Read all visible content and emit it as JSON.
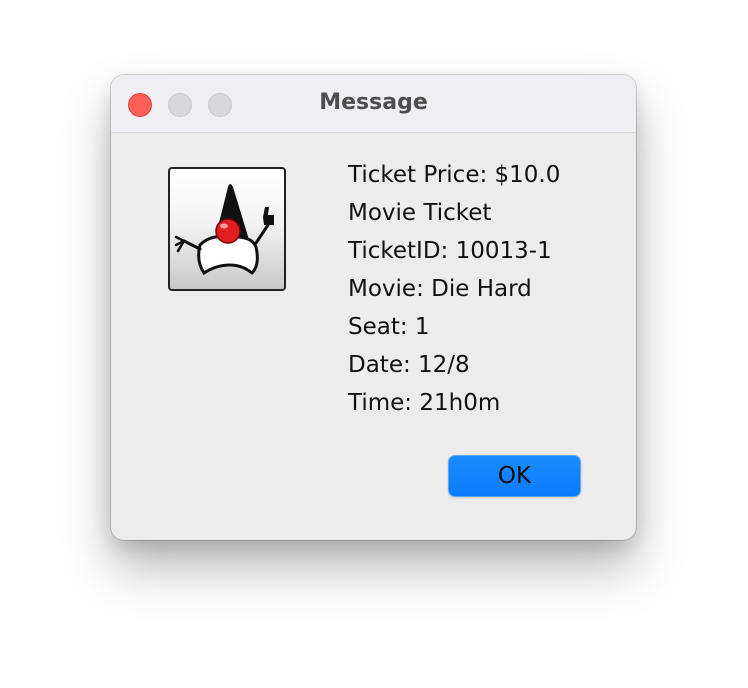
{
  "window": {
    "title": "Message"
  },
  "icon": {
    "name": "java-duke-icon"
  },
  "message": {
    "lines": [
      "Ticket Price: $10.0",
      "Movie Ticket",
      "TicketID: 10013-1",
      "Movie: Die Hard",
      "Seat: 1",
      "Date: 12/8",
      "Time: 21h0m"
    ]
  },
  "buttons": {
    "ok_label": "OK"
  },
  "colors": {
    "accent": "#0a7bff",
    "close": "#fe5f57",
    "dialog_bg": "#ececec"
  }
}
